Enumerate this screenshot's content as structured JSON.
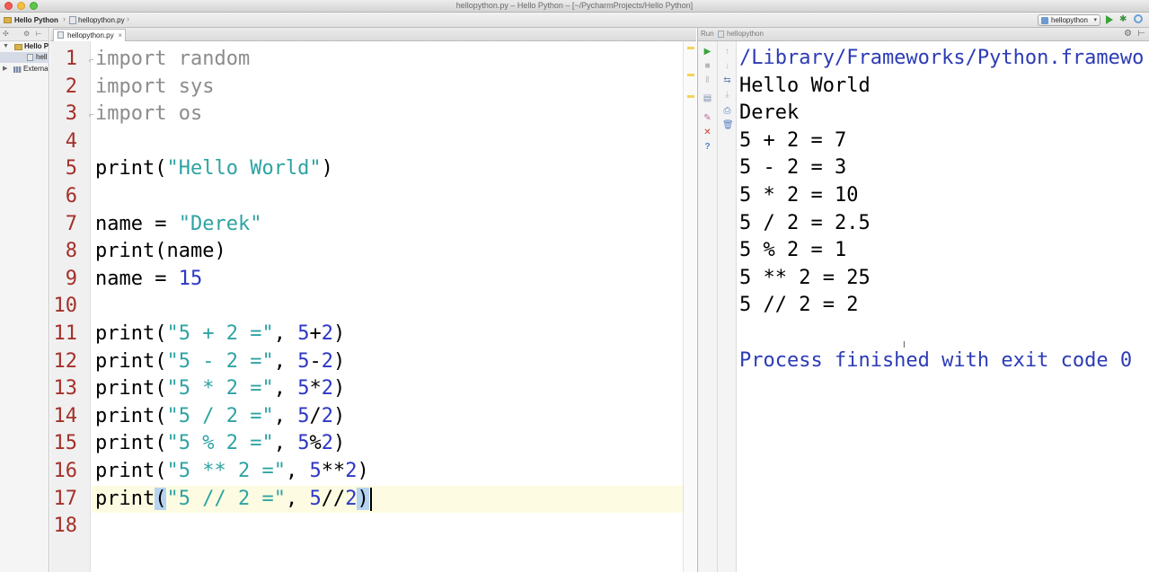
{
  "window": {
    "title": "hellopython.py – Hello Python – [~/PycharmProjects/Hello Python]"
  },
  "navbar": {
    "crumbs": [
      "Hello Python",
      "hellopython.py"
    ],
    "run_config": "hellopython"
  },
  "project": {
    "root": "Hello P",
    "file": "hell",
    "external": "Externa"
  },
  "editor": {
    "tab": "hellopython.py",
    "line_numbers": [
      "1",
      "2",
      "3",
      "4",
      "5",
      "6",
      "7",
      "8",
      "9",
      "10",
      "11",
      "12",
      "13",
      "14",
      "15",
      "16",
      "17",
      "18"
    ],
    "lines": [
      [
        {
          "t": "import random",
          "c": "kw-import"
        }
      ],
      [
        {
          "t": "import sys",
          "c": "kw-import"
        }
      ],
      [
        {
          "t": "import os",
          "c": "kw-import"
        }
      ],
      [],
      [
        {
          "t": "print("
        },
        {
          "t": "\"Hello World\"",
          "c": "str"
        },
        {
          "t": ")"
        }
      ],
      [],
      [
        {
          "t": "name = "
        },
        {
          "t": "\"Derek\"",
          "c": "str"
        }
      ],
      [
        {
          "t": "print(name)"
        }
      ],
      [
        {
          "t": "name = "
        },
        {
          "t": "15",
          "c": "num"
        }
      ],
      [],
      [
        {
          "t": "print("
        },
        {
          "t": "\"5 + 2 =\"",
          "c": "str"
        },
        {
          "t": ", "
        },
        {
          "t": "5",
          "c": "num"
        },
        {
          "t": "+"
        },
        {
          "t": "2",
          "c": "num"
        },
        {
          "t": ")"
        }
      ],
      [
        {
          "t": "print("
        },
        {
          "t": "\"5 - 2 =\"",
          "c": "str"
        },
        {
          "t": ", "
        },
        {
          "t": "5",
          "c": "num"
        },
        {
          "t": "-"
        },
        {
          "t": "2",
          "c": "num"
        },
        {
          "t": ")"
        }
      ],
      [
        {
          "t": "print("
        },
        {
          "t": "\"5 * 2 =\"",
          "c": "str"
        },
        {
          "t": ", "
        },
        {
          "t": "5",
          "c": "num"
        },
        {
          "t": "*"
        },
        {
          "t": "2",
          "c": "num"
        },
        {
          "t": ")"
        }
      ],
      [
        {
          "t": "print("
        },
        {
          "t": "\"5 / 2 =\"",
          "c": "str"
        },
        {
          "t": ", "
        },
        {
          "t": "5",
          "c": "num"
        },
        {
          "t": "/"
        },
        {
          "t": "2",
          "c": "num"
        },
        {
          "t": ")"
        }
      ],
      [
        {
          "t": "print("
        },
        {
          "t": "\"5 % 2 =\"",
          "c": "str"
        },
        {
          "t": ", "
        },
        {
          "t": "5",
          "c": "num"
        },
        {
          "t": "%"
        },
        {
          "t": "2",
          "c": "num"
        },
        {
          "t": ")"
        }
      ],
      [
        {
          "t": "print("
        },
        {
          "t": "\"5 ** 2 =\"",
          "c": "str"
        },
        {
          "t": ", "
        },
        {
          "t": "5",
          "c": "num"
        },
        {
          "t": "**"
        },
        {
          "t": "2",
          "c": "num"
        },
        {
          "t": ")"
        }
      ],
      [
        {
          "t": "print"
        },
        {
          "t": "(",
          "c": "paren-match"
        },
        {
          "t": "\"5 // 2 =\"",
          "c": "str"
        },
        {
          "t": ", "
        },
        {
          "t": "5",
          "c": "num"
        },
        {
          "t": "//"
        },
        {
          "t": "2",
          "c": "num"
        },
        {
          "t": ")",
          "c": "paren-match caret-after"
        }
      ],
      []
    ]
  },
  "run": {
    "label": "Run",
    "tab": "hellopython",
    "output": [
      "/Library/Frameworks/Python.framewo",
      "Hello World",
      "Derek",
      "5 + 2 = 7",
      "5 - 2 = 3",
      "5 * 2 = 10",
      "5 / 2 = 2.5",
      "5 % 2 = 1",
      "5 ** 2 = 25",
      "5 // 2 = 2",
      "",
      "Process finished with exit code 0"
    ]
  },
  "colors": {
    "line_number": "#a4302a",
    "string": "#2fa3a3",
    "number": "#2c37c4",
    "import": "#8c8c8c",
    "console_info": "#2c3bb5",
    "current_line": "#fdfce2",
    "paren_match": "#b5d4f0"
  }
}
